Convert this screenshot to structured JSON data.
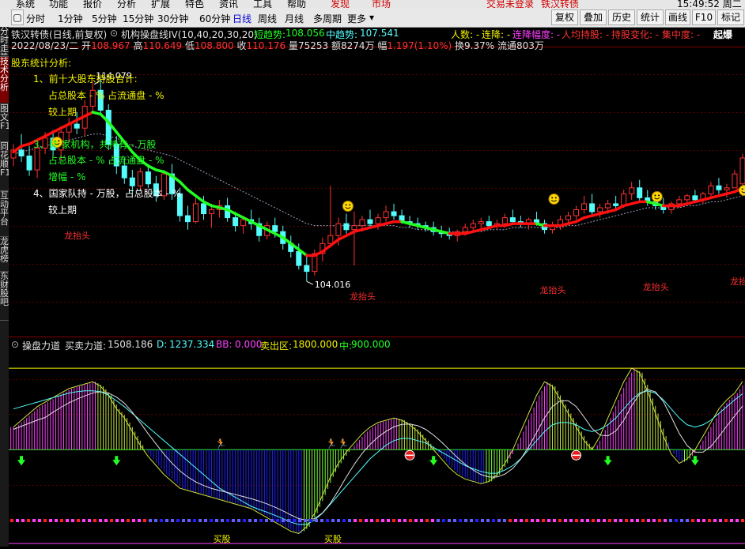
{
  "menu": {
    "items": [
      "系统",
      "功能",
      "报价",
      "分析",
      "扩展",
      "特色",
      "资讯",
      "工具",
      "帮助"
    ],
    "discover": "发现",
    "market": "市场",
    "login_status": "交易未登录",
    "stock_name": "铁汉转债",
    "time": "15:49:52 周二"
  },
  "periods": [
    "分时",
    "1分钟",
    "5分钟",
    "15分钟",
    "30分钟",
    "60分钟",
    "日线",
    "周线",
    "月线",
    "多周期",
    "更多"
  ],
  "active_period": "日线",
  "toolbar_right": [
    "复权",
    "叠加",
    "历史",
    "统计",
    "画线",
    "F10",
    "标记"
  ],
  "side_tabs": [
    {
      "label": "分时走势",
      "active": false
    },
    {
      "label": "技术分析",
      "active": true
    },
    {
      "label": "图文F10",
      "active": false
    },
    {
      "label": "同花顺F10",
      "active": false
    },
    {
      "label": "互动平台",
      "active": false
    },
    {
      "label": "龙虎榜",
      "active": false
    },
    {
      "label": "东财股吧",
      "active": false
    }
  ],
  "kline_panel": {
    "title": "铁汉转债(日线,前复权)",
    "indicator": "机构操盘线IV(10,40,20,30,20)",
    "short_trend_label": "短趋势:",
    "short_trend_value": "108.056",
    "mid_trend_label": "中趋势:",
    "mid_trend_value": "107.541",
    "right_items": [
      "人数: -",
      "连降: -",
      "连降幅度: -",
      "人均持股: -",
      "持股变化: -",
      "集中度: -"
    ],
    "right_tag": "起爆",
    "quote": {
      "date": "2022/08/23/二",
      "open_label": "开",
      "open": "108.967",
      "high_label": "高",
      "high": "110.649",
      "low_label": "低",
      "low": "108.800",
      "close_label": "收",
      "close": "110.176",
      "vol_label": "量",
      "vol": "75253",
      "amt_label": "额",
      "amt": "8274万",
      "chg_label": "幅",
      "chg": "1.197(1.10%)",
      "turn_label": "换",
      "turn": "9.37%",
      "float_label": "流通",
      "float": "803万"
    },
    "analysis": {
      "heading": "股东统计分析:",
      "l1": "1、前十大股东持股合计:",
      "l2": "占总股本 - %   占流通盘 - %",
      "l3": "较上期",
      "l4": "3、共   家机构，共持有 - 万股",
      "l5": "占总股本 - %   占流通盘 - %",
      "l6": "增幅 - %",
      "l7": "4、国家队持 - 万股，占总股本 - %",
      "l8": "较上期"
    },
    "high_mark": "114.079",
    "low_mark": "104.016",
    "dragon_label": "龙抬头"
  },
  "sub_panel": {
    "title": "操盘力道",
    "buy_sell_label": "买卖力道:",
    "buy_sell_value": "1508.186",
    "d_label": "D:",
    "d_value": "1237.334",
    "bb_label": "BB:",
    "bb_value": "0.000",
    "sell_zone_label": "卖出区:",
    "sell_zone_value": "1800.000",
    "mid_label": "中:",
    "mid_value": "900.000",
    "buy_label": "买股"
  },
  "colors": {
    "up": "#ff3232",
    "down": "#54fcfc",
    "short_line": "#ff1010",
    "short_line_down": "#22ff22",
    "mid_line": "#a0a0c0",
    "gold": "#f0f000",
    "magenta": "#ff40ff",
    "blue": "#2020ff",
    "cyan": "#54fcfc"
  },
  "chart_data": {
    "type": "candlestick",
    "ylim": [
      102.5,
      115.2
    ],
    "candles": [
      [
        110.2,
        110.9,
        109.8,
        110.6
      ],
      [
        110.6,
        111.4,
        110.0,
        110.3
      ],
      [
        110.3,
        110.8,
        109.3,
        109.6
      ],
      [
        109.6,
        110.9,
        109.2,
        110.7
      ],
      [
        110.7,
        111.5,
        110.4,
        111.2
      ],
      [
        111.2,
        111.6,
        110.3,
        110.6
      ],
      [
        110.6,
        111.8,
        110.1,
        111.5
      ],
      [
        111.5,
        112.2,
        111.0,
        111.9
      ],
      [
        111.9,
        112.5,
        111.4,
        111.7
      ],
      [
        111.7,
        113.1,
        111.3,
        112.8
      ],
      [
        112.8,
        114.0,
        112.5,
        113.6
      ],
      [
        113.6,
        114.1,
        112.4,
        112.6
      ],
      [
        112.6,
        112.9,
        110.6,
        110.9
      ],
      [
        110.9,
        111.3,
        109.4,
        109.8
      ],
      [
        109.8,
        110.2,
        108.9,
        109.2
      ],
      [
        109.2,
        109.6,
        108.4,
        108.8
      ],
      [
        108.8,
        109.7,
        108.6,
        109.5
      ],
      [
        109.5,
        109.9,
        108.7,
        108.9
      ],
      [
        108.9,
        109.3,
        108.0,
        108.3
      ],
      [
        108.3,
        109.6,
        108.1,
        109.4
      ],
      [
        109.4,
        109.9,
        108.1,
        108.4
      ],
      [
        108.4,
        108.7,
        107.0,
        107.3
      ],
      [
        107.3,
        107.8,
        106.6,
        107.0
      ],
      [
        107.0,
        108.2,
        106.9,
        107.9
      ],
      [
        107.9,
        108.3,
        107.1,
        107.4
      ],
      [
        107.4,
        107.9,
        106.7,
        107.6
      ],
      [
        107.6,
        108.1,
        107.2,
        107.8
      ],
      [
        107.8,
        108.2,
        107.0,
        107.2
      ],
      [
        107.2,
        107.5,
        106.5,
        106.8
      ],
      [
        106.8,
        107.3,
        106.4,
        107.1
      ],
      [
        107.1,
        107.6,
        106.6,
        106.9
      ],
      [
        106.9,
        107.2,
        106.0,
        106.3
      ],
      [
        106.3,
        107.0,
        106.1,
        106.8
      ],
      [
        106.8,
        107.2,
        106.2,
        106.5
      ],
      [
        106.5,
        106.8,
        105.6,
        105.9
      ],
      [
        105.9,
        106.3,
        105.2,
        105.5
      ],
      [
        105.5,
        105.9,
        104.6,
        104.8
      ],
      [
        104.8,
        105.3,
        104.0,
        104.5
      ],
      [
        104.5,
        105.6,
        104.3,
        105.4
      ],
      [
        105.4,
        106.2,
        105.0,
        105.9
      ],
      [
        105.9,
        108.8,
        105.7,
        106.3
      ],
      [
        106.3,
        107.2,
        105.8,
        106.9
      ],
      [
        106.9,
        107.4,
        106.4,
        106.6
      ],
      [
        106.6,
        107.5,
        104.8,
        106.8
      ],
      [
        106.8,
        107.3,
        106.5,
        107.1
      ],
      [
        107.1,
        107.6,
        106.7,
        106.9
      ],
      [
        106.9,
        107.4,
        106.6,
        107.2
      ],
      [
        107.2,
        107.8,
        107.0,
        107.5
      ],
      [
        107.5,
        107.9,
        107.1,
        107.3
      ],
      [
        107.3,
        107.6,
        106.9,
        107.0
      ],
      [
        107.0,
        107.3,
        106.7,
        106.9
      ],
      [
        106.9,
        107.2,
        106.6,
        106.8
      ],
      [
        106.8,
        107.0,
        106.5,
        106.7
      ],
      [
        106.7,
        107.0,
        106.3,
        106.5
      ],
      [
        106.5,
        106.8,
        106.2,
        106.4
      ],
      [
        106.4,
        106.7,
        106.1,
        106.3
      ],
      [
        106.3,
        106.6,
        106.0,
        106.5
      ],
      [
        106.5,
        106.9,
        106.3,
        106.7
      ],
      [
        106.7,
        107.1,
        106.5,
        106.9
      ],
      [
        106.9,
        107.2,
        106.6,
        107.0
      ],
      [
        107.0,
        107.3,
        106.7,
        106.8
      ],
      [
        106.8,
        107.1,
        106.6,
        106.9
      ],
      [
        106.9,
        107.4,
        106.7,
        107.2
      ],
      [
        107.2,
        107.6,
        106.9,
        107.0
      ],
      [
        107.0,
        107.3,
        106.7,
        106.9
      ],
      [
        106.9,
        107.2,
        106.6,
        107.1
      ],
      [
        107.1,
        107.5,
        106.8,
        106.9
      ],
      [
        106.9,
        107.1,
        106.4,
        106.6
      ],
      [
        106.6,
        107.0,
        106.4,
        106.8
      ],
      [
        106.8,
        107.3,
        106.6,
        107.1
      ],
      [
        107.1,
        107.5,
        106.9,
        107.3
      ],
      [
        107.3,
        107.8,
        107.1,
        107.6
      ],
      [
        107.6,
        108.3,
        107.4,
        107.9
      ],
      [
        107.9,
        108.4,
        107.3,
        107.5
      ],
      [
        107.5,
        107.9,
        107.2,
        107.7
      ],
      [
        107.7,
        108.1,
        107.4,
        107.9
      ],
      [
        107.9,
        108.3,
        107.6,
        107.8
      ],
      [
        107.8,
        108.6,
        107.7,
        108.4
      ],
      [
        108.4,
        109.0,
        108.1,
        108.7
      ],
      [
        108.7,
        109.1,
        108.0,
        108.2
      ],
      [
        108.2,
        108.6,
        107.8,
        108.0
      ],
      [
        108.0,
        108.4,
        107.6,
        107.8
      ],
      [
        107.8,
        108.2,
        107.4,
        107.6
      ],
      [
        107.6,
        108.0,
        107.4,
        107.9
      ],
      [
        107.9,
        108.3,
        107.7,
        108.1
      ],
      [
        108.1,
        108.4,
        107.9,
        108.3
      ],
      [
        108.3,
        108.6,
        108.0,
        108.1
      ],
      [
        108.1,
        108.5,
        107.9,
        108.4
      ],
      [
        108.4,
        109.0,
        108.2,
        108.8
      ],
      [
        108.8,
        109.2,
        108.4,
        108.6
      ],
      [
        108.6,
        108.9,
        108.2,
        108.7
      ],
      [
        108.7,
        109.6,
        108.9,
        109.4
      ],
      [
        108.9,
        110.4,
        108.8,
        110.2
      ]
    ],
    "short_trend": [
      110.5,
      110.8,
      110.9,
      111.1,
      111.3,
      111.5,
      111.7,
      111.9,
      112.1,
      112.3,
      112.5,
      112.4,
      112.0,
      111.5,
      111.0,
      110.5,
      110.1,
      109.8,
      109.6,
      109.5,
      109.3,
      109.0,
      108.6,
      108.3,
      108.0,
      107.8,
      107.7,
      107.6,
      107.4,
      107.2,
      107.0,
      106.8,
      106.6,
      106.4,
      106.2,
      105.9,
      105.6,
      105.3,
      105.3,
      105.5,
      105.8,
      106.1,
      106.3,
      106.5,
      106.6,
      106.7,
      106.8,
      106.9,
      107.0,
      107.0,
      106.9,
      106.8,
      106.7,
      106.6,
      106.5,
      106.4,
      106.4,
      106.4,
      106.5,
      106.6,
      106.7,
      106.8,
      106.8,
      106.9,
      106.9,
      106.9,
      106.9,
      106.8,
      106.8,
      106.8,
      106.9,
      107.0,
      107.2,
      107.3,
      107.4,
      107.5,
      107.6,
      107.8,
      107.9,
      108.0,
      108.0,
      107.9,
      107.8,
      107.8,
      107.8,
      107.9,
      108.0,
      108.1,
      108.2,
      108.3,
      108.4,
      108.5,
      108.7
    ],
    "mid_trend": [
      110.4,
      110.5,
      110.6,
      110.7,
      110.8,
      110.9,
      111.0,
      111.1,
      111.2,
      111.3,
      111.4,
      111.4,
      111.3,
      111.2,
      111.0,
      110.8,
      110.7,
      110.6,
      110.5,
      110.4,
      110.3,
      110.1,
      109.9,
      109.7,
      109.5,
      109.3,
      109.1,
      108.9,
      108.7,
      108.5,
      108.3,
      108.1,
      107.9,
      107.7,
      107.5,
      107.3,
      107.1,
      106.9,
      106.8,
      106.8,
      106.8,
      106.8,
      106.8,
      106.8,
      106.8,
      106.8,
      106.8,
      106.8,
      106.8,
      106.7,
      106.7,
      106.6,
      106.6,
      106.5,
      106.5,
      106.5,
      106.5,
      106.5,
      106.5,
      106.5,
      106.6,
      106.6,
      106.6,
      106.7,
      106.7,
      106.7,
      106.7,
      106.7,
      106.7,
      106.7,
      106.8,
      106.8,
      106.9,
      107.0,
      107.1,
      107.2,
      107.3,
      107.4,
      107.5,
      107.6,
      107.7,
      107.7,
      107.7,
      107.7,
      107.7,
      107.8,
      107.8,
      107.9,
      108.0,
      108.0,
      108.1,
      108.2,
      108.3
    ],
    "force": [
      500,
      650,
      800,
      950,
      1050,
      1150,
      1250,
      1350,
      1400,
      1450,
      1500,
      1400,
      1200,
      900,
      700,
      400,
      100,
      -150,
      -350,
      -550,
      -700,
      -850,
      -900,
      -950,
      -1000,
      -1050,
      -1100,
      -1150,
      -1200,
      -1250,
      -1300,
      -1400,
      -1500,
      -1600,
      -1700,
      -1800,
      -1850,
      -1700,
      -1400,
      -1000,
      -600,
      -300,
      -50,
      150,
      350,
      500,
      600,
      650,
      700,
      650,
      550,
      400,
      200,
      0,
      -200,
      -400,
      -550,
      -650,
      -700,
      -750,
      -700,
      -550,
      -300,
      0,
      400,
      800,
      1200,
      1500,
      1400,
      1100,
      800,
      500,
      200,
      0,
      300,
      700,
      1100,
      1500,
      1800,
      1700,
      1300,
      800,
      300,
      -100,
      -300,
      -200,
      0,
      300,
      600,
      900,
      1100,
      1250,
      1508
    ],
    "d_line": [
      900,
      950,
      1000,
      1050,
      1100,
      1150,
      1200,
      1250,
      1280,
      1300,
      1300,
      1280,
      1200,
      1080,
      950,
      800,
      650,
      500,
      350,
      200,
      50,
      -100,
      -250,
      -400,
      -550,
      -700,
      -850,
      -950,
      -1050,
      -1150,
      -1250,
      -1320,
      -1380,
      -1450,
      -1520,
      -1600,
      -1650,
      -1650,
      -1550,
      -1400,
      -1200,
      -1000,
      -800,
      -600,
      -400,
      -200,
      -50,
      100,
      200,
      250,
      250,
      200,
      150,
      50,
      -50,
      -150,
      -250,
      -350,
      -420,
      -480,
      -520,
      -520,
      -450,
      -350,
      -200,
      0,
      200,
      400,
      550,
      600,
      600,
      550,
      450,
      400,
      450,
      550,
      700,
      900,
      1100,
      1250,
      1300,
      1250,
      1100,
      900,
      700,
      550,
      500,
      550,
      650,
      800,
      950,
      1100,
      1237
    ],
    "sell_zone": 1800,
    "mid_level": 900,
    "force_ylim": [
      -2000,
      2150
    ],
    "dragon_marks": [
      8,
      44,
      68,
      81,
      92
    ],
    "smiley_marks": [
      42,
      68,
      81,
      92
    ],
    "green_arrows": [
      1,
      13,
      53,
      75,
      86
    ],
    "red_balls": [
      50,
      71
    ],
    "buy_marks": [
      26,
      40
    ]
  }
}
